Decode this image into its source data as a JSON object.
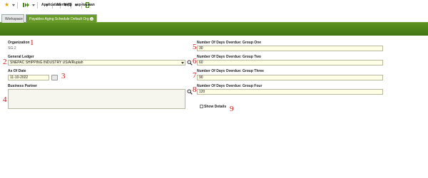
{
  "toolbar": {
    "menus": [
      {
        "label": "Application"
      },
      {
        "label": "Alerts (0)"
      },
      {
        "label": "Help"
      },
      {
        "label": "asp-kapnan"
      }
    ]
  },
  "tabs": {
    "workspace": "Workspace",
    "active": "Payables Aging Schedule Default Org"
  },
  "form": {
    "organization": {
      "label": "Organization",
      "value": "SG-2",
      "marker": "1"
    },
    "general_ledger": {
      "label": "General Ledger",
      "value": "SNEPAC SHIPPING INDUSTRY US/A/Rupiah",
      "marker": "2"
    },
    "as_of_date": {
      "label": "As Of Date",
      "value": "11-10-2022",
      "marker": "3"
    },
    "business_partner": {
      "label": "Business Partner",
      "value": "",
      "marker": "4"
    },
    "group_one": {
      "label": "Number Of Days Overdue: Group One",
      "value": "30",
      "marker": "5"
    },
    "group_two": {
      "label": "Number Of Days Overdue: Group Two",
      "value": "60",
      "marker": "6"
    },
    "group_three": {
      "label": "Number Of Days Overdue: Group Three",
      "value": "90",
      "marker": "7"
    },
    "group_four": {
      "label": "Number Of Days Overdue: Group Four",
      "value": "120",
      "marker": "8"
    },
    "show_details": {
      "label": "Show Details",
      "checked": false,
      "marker": "9"
    }
  },
  "colors": {
    "brand_green": "#5e9221",
    "field_bg": "#ffffe6",
    "marker_red": "#d01010"
  }
}
